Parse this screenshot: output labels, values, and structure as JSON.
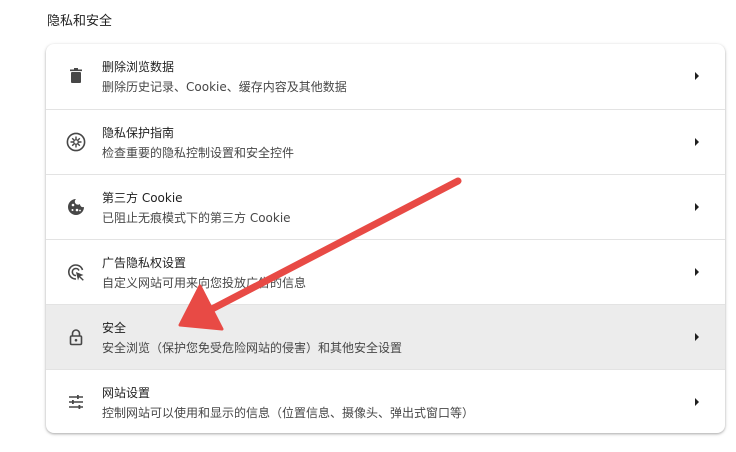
{
  "section": {
    "title": "隐私和安全"
  },
  "rows": [
    {
      "title": "删除浏览数据",
      "subtitle": "删除历史记录、Cookie、缓存内容及其他数据",
      "icon": "trash-icon"
    },
    {
      "title": "隐私保护指南",
      "subtitle": "检查重要的隐私控制设置和安全控件",
      "icon": "privacy-guide-icon"
    },
    {
      "title": "第三方 Cookie",
      "subtitle": "已阻止无痕模式下的第三方 Cookie",
      "icon": "cookie-icon"
    },
    {
      "title": "广告隐私权设置",
      "subtitle": "自定义网站可用来向您投放广告的信息",
      "icon": "ad-privacy-icon"
    },
    {
      "title": "安全",
      "subtitle": "安全浏览（保护您免受危险网站的侵害）和其他安全设置",
      "icon": "lock-icon"
    },
    {
      "title": "网站设置",
      "subtitle": "控制网站可以使用和显示的信息（位置信息、摄像头、弹出式窗口等）",
      "icon": "tune-icon"
    }
  ],
  "colors": {
    "hover_row": "#ececec",
    "annotation_arrow": "#e84a45",
    "divider": "#e3e3e3"
  },
  "annotation": {
    "type": "arrow",
    "points_to": "安全"
  }
}
